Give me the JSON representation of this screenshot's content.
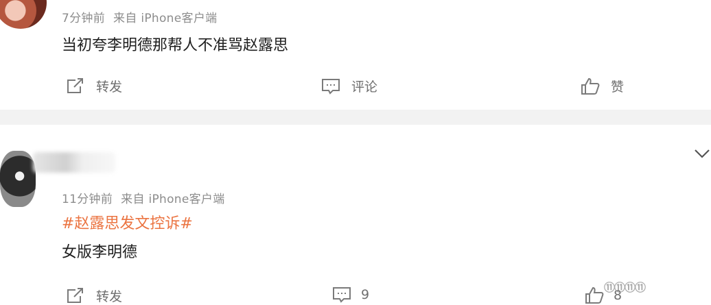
{
  "post1": {
    "time": "7分钟前",
    "source": "来自 iPhone客户端",
    "text": "当初夸李明德那帮人不准骂赵露思",
    "actions": {
      "repost": "转发",
      "comment": "评论",
      "like": "赞"
    }
  },
  "post2": {
    "time": "11分钟前",
    "source": "来自 iPhone客户端",
    "hashtag": "#赵露思发文控诉#",
    "text": "女版李明德",
    "actions": {
      "repost": "转发",
      "comment_count": "9",
      "like_count": "8"
    }
  },
  "watermark": "⑪⑪⑪⑪",
  "colors": {
    "hashtag": "#eb7340",
    "meta": "#8c8c8c",
    "divider": "#f2f2f2"
  },
  "icons": [
    "repost-icon",
    "comment-icon",
    "like-icon",
    "chevron-down-icon"
  ]
}
